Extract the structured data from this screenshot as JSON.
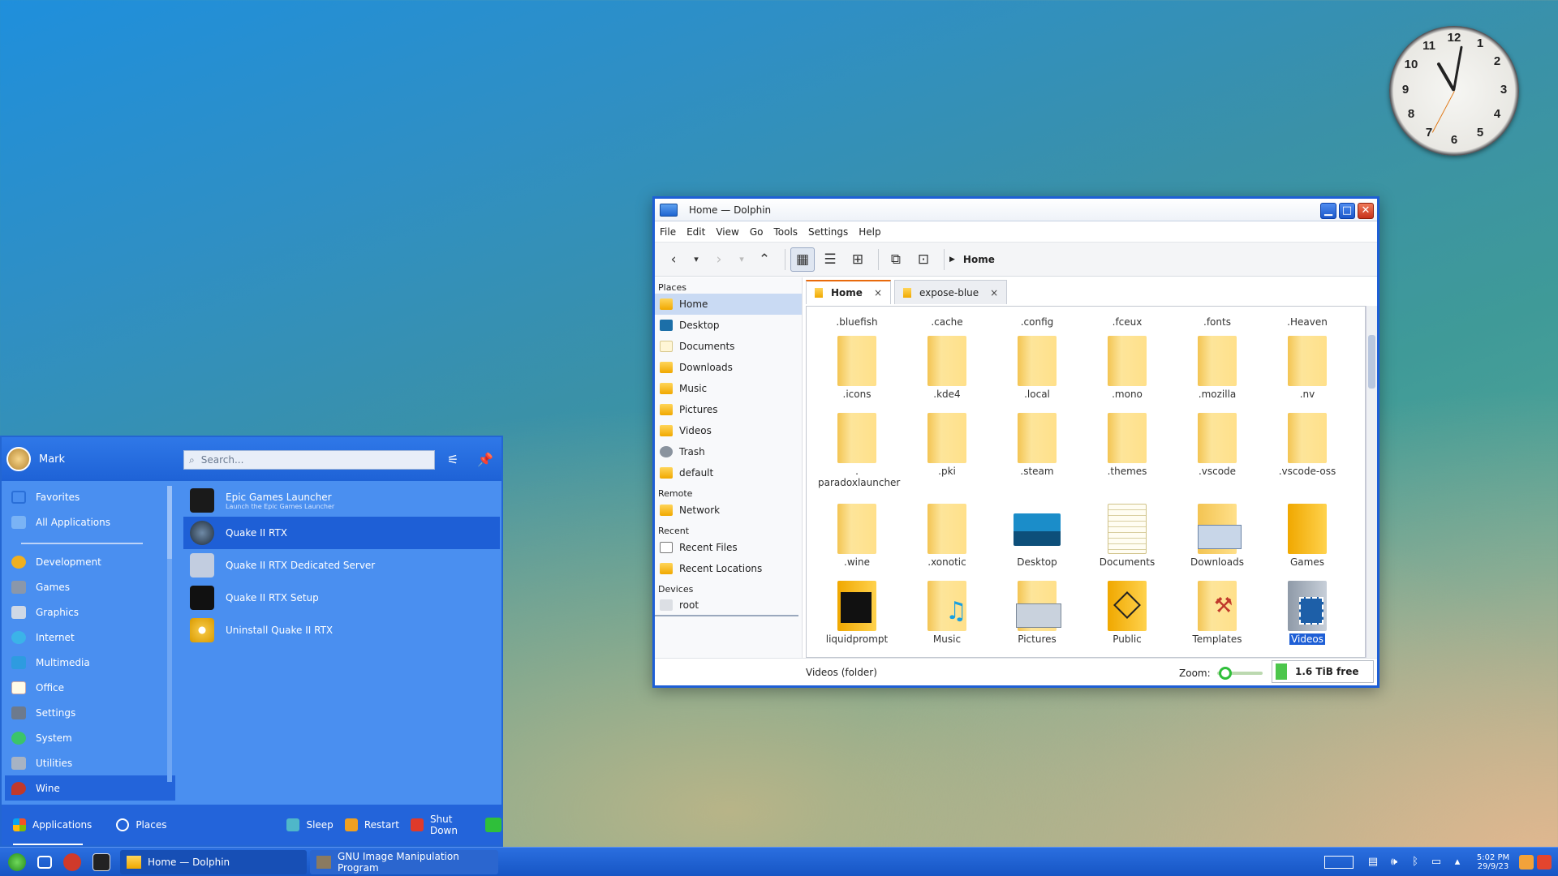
{
  "clock": {
    "numerals": [
      "12",
      "1",
      "2",
      "3",
      "4",
      "5",
      "6",
      "7",
      "8",
      "9",
      "10",
      "11"
    ]
  },
  "dolphin": {
    "title": "Home — Dolphin",
    "menu": [
      "File",
      "Edit",
      "View",
      "Go",
      "Tools",
      "Settings",
      "Help"
    ],
    "breadcrumb": "Home",
    "places": {
      "header": "Places",
      "items": [
        "Home",
        "Desktop",
        "Documents",
        "Downloads",
        "Music",
        "Pictures",
        "Videos",
        "Trash",
        "default"
      ],
      "remote_header": "Remote",
      "remote_items": [
        "Network"
      ],
      "recent_header": "Recent",
      "recent_items": [
        "Recent Files",
        "Recent Locations"
      ],
      "devices_header": "Devices",
      "devices_items": [
        "root"
      ]
    },
    "tabs": [
      {
        "label": "Home",
        "close": "×"
      },
      {
        "label": "expose-blue",
        "close": "×"
      }
    ],
    "top_row": [
      ".bluefish",
      ".cache",
      ".config",
      ".fceux",
      ".fonts",
      ".Heaven"
    ],
    "row1": [
      ".icons",
      ".kde4",
      ".local",
      ".mono",
      ".mozilla",
      ".nv"
    ],
    "row2": [
      ".\nparadoxlauncher",
      ".pki",
      ".steam",
      ".themes",
      ".vscode",
      ".vscode-oss"
    ],
    "row3": [
      ".wine",
      ".xonotic",
      "Desktop",
      "Documents",
      "Downloads",
      "Games"
    ],
    "row4": [
      "liquidprompt",
      "Music",
      "Pictures",
      "Public",
      "Templates",
      "Videos"
    ],
    "selected_item": "Videos",
    "status": "Videos (folder)",
    "zoom_label": "Zoom:",
    "free_space": "1.6 TiB free"
  },
  "launcher": {
    "user": "Mark",
    "search_placeholder": "Search...",
    "favorites": [
      "Favorites",
      "All Applications"
    ],
    "categories": [
      "Development",
      "Games",
      "Graphics",
      "Internet",
      "Multimedia",
      "Office",
      "Settings",
      "System",
      "Utilities",
      "Wine"
    ],
    "selected_category": "Wine",
    "apps": [
      {
        "name": "Epic Games Launcher",
        "desc": "Launch the Epic Games Launcher"
      },
      {
        "name": "Quake II RTX",
        "desc": ""
      },
      {
        "name": "Quake II RTX Dedicated Server",
        "desc": ""
      },
      {
        "name": "Quake II RTX Setup",
        "desc": ""
      },
      {
        "name": "Uninstall Quake II RTX",
        "desc": ""
      }
    ],
    "footer": {
      "applications": "Applications",
      "places": "Places",
      "sleep": "Sleep",
      "restart": "Restart",
      "shutdown": "Shut Down"
    }
  },
  "taskbar": {
    "tasks": [
      "Home — Dolphin",
      "GNU Image Manipulation Program"
    ],
    "time": "5:02 PM",
    "date": "29/9/23"
  },
  "colors": {
    "accent": "#1e5fd6",
    "folder": "#ffd24d",
    "launcher_bg": "#4a8ff0",
    "taskbar": "#1b5fd2"
  }
}
